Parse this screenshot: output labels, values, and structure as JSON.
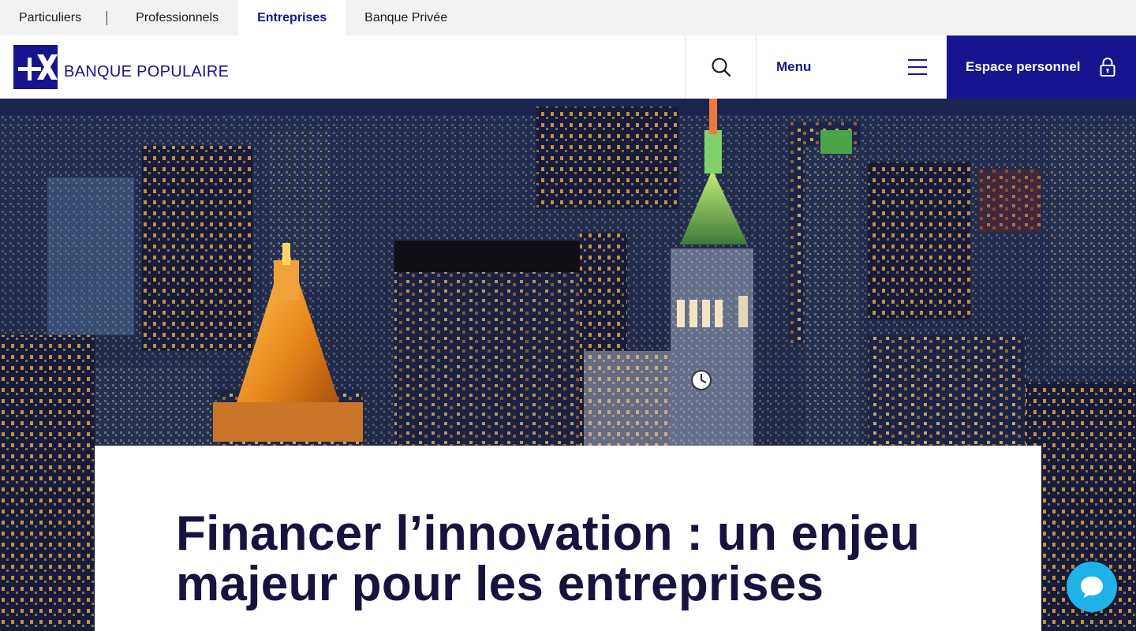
{
  "segments": [
    {
      "label": "Particuliers",
      "active": false
    },
    {
      "label": "Professionnels",
      "active": false
    },
    {
      "label": "Entreprises",
      "active": true
    },
    {
      "label": "Banque Privée",
      "active": false
    }
  ],
  "header": {
    "brand_name": "BANQUE POPULAIRE",
    "logo_mark_text": "+X",
    "search_icon": "search-icon",
    "menu_label": "Menu",
    "menu_icon": "hamburger-icon",
    "espace_label": "Espace personnel",
    "espace_icon": "lock-icon"
  },
  "hero": {
    "image": "night-aerial-city-skyline"
  },
  "article": {
    "title_line1": "Financer l’innovation : un enjeu",
    "title_line2": "majeur pour les entreprises"
  },
  "chat": {
    "icon": "chat-bubble-icon"
  },
  "colors": {
    "brand": "#16148e",
    "title": "#16143f",
    "chat": "#1fb2e8",
    "segbar_bg": "#f2f2f2"
  }
}
